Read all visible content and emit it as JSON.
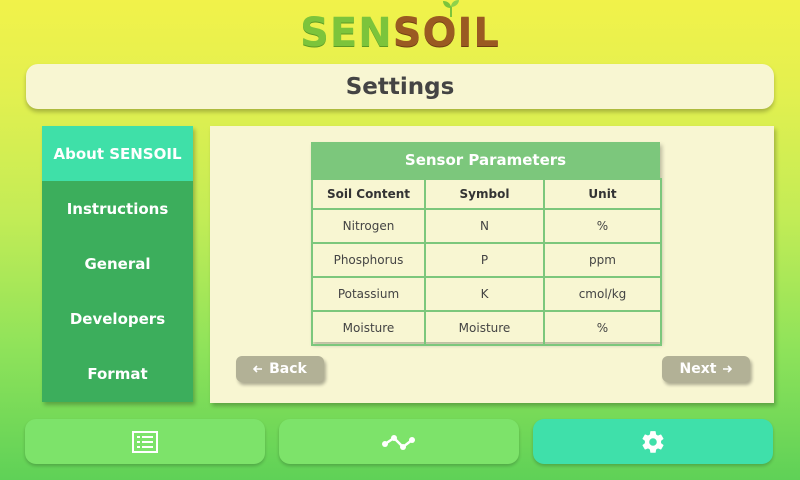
{
  "logo": {
    "part1": "SEN",
    "part2": "S",
    "part3": "O",
    "part4": "IL"
  },
  "header": {
    "title": "Settings"
  },
  "sidebar": {
    "items": [
      {
        "label": "About SENSOIL",
        "active": true
      },
      {
        "label": "Instructions",
        "active": false
      },
      {
        "label": "General",
        "active": false
      },
      {
        "label": "Developers",
        "active": false
      },
      {
        "label": "Format",
        "active": false
      }
    ]
  },
  "table": {
    "title": "Sensor Parameters",
    "headers": [
      "Soil Content",
      "Symbol",
      "Unit"
    ],
    "rows": [
      [
        "Nitrogen",
        "N",
        "%"
      ],
      [
        "Phosphorus",
        "P",
        "ppm"
      ],
      [
        "Potassium",
        "K",
        "cmol/kg"
      ],
      [
        "Moisture",
        "Moisture",
        "%"
      ]
    ]
  },
  "buttons": {
    "back": "Back",
    "next": "Next",
    "back_icon": "arrow-left-icon",
    "next_icon": "arrow-right-icon"
  },
  "bottom_nav": [
    {
      "icon": "list-icon",
      "active": false
    },
    {
      "icon": "chart-line-icon",
      "active": false
    },
    {
      "icon": "gear-icon",
      "active": true
    }
  ],
  "colors": {
    "sidebar": "#3cae5c",
    "sidebar_active": "#3fe0a8",
    "panel": "#f8f6d2",
    "table_header": "#7cc77c",
    "button": "#b2b196",
    "nav": "#7de36a",
    "nav_active": "#3fe0aa"
  }
}
